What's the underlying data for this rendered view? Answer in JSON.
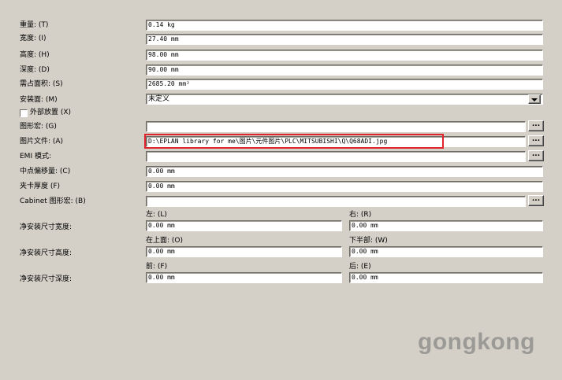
{
  "labels": {
    "weight": "重量: (T)",
    "width": "宽度: (I)",
    "height": "高度: (H)",
    "depth": "深度: (D)",
    "area": "需占面积: (S)",
    "mount_surface": "安装面: (M)",
    "external_placement": "外部放置 (X)",
    "graphic_macro": "图形宏: (G)",
    "image_file": "图片文件: (A)",
    "emi_mode": "EMI 模式:",
    "center_offset": "中点偏移量: (C)",
    "clamp_thickness": "夹卡厚度 (F)",
    "cabinet_macro": "Cabinet 图形宏: (B)",
    "net_width": "净安装尺寸宽度:",
    "net_height": "净安装尺寸高度:",
    "net_depth": "净安装尺寸深度:"
  },
  "values": {
    "weight": "0.14 kg",
    "width": "27.40 mm",
    "height": "98.00 mm",
    "depth": "90.00 mm",
    "area": "2685.20 mm²",
    "mount_surface": "未定义",
    "graphic_macro": "",
    "image_file": "D:\\EPLAN library for me\\图片\\元件图片\\PLC\\MITSUBISHI\\Q\\Q68ADI.jpg",
    "emi_mode": "",
    "center_offset": "0.00 mm",
    "clamp_thickness": "0.00 mm",
    "cabinet_macro": ""
  },
  "sublabels": {
    "left": "左: (L)",
    "right": "右: (R)",
    "top": "在上面: (O)",
    "bottom": "下半部: (W)",
    "front": "前: (F)",
    "back": "后: (E)"
  },
  "net_values": {
    "left": "0.00 mm",
    "right": "0.00 mm",
    "top": "0.00 mm",
    "bottom": "0.00 mm",
    "front": "0.00 mm",
    "back": "0.00 mm"
  },
  "browse_label": "...",
  "watermark": "gongkong",
  "colors": {
    "highlight": "#e0242c",
    "background": "#d4d0c8"
  }
}
